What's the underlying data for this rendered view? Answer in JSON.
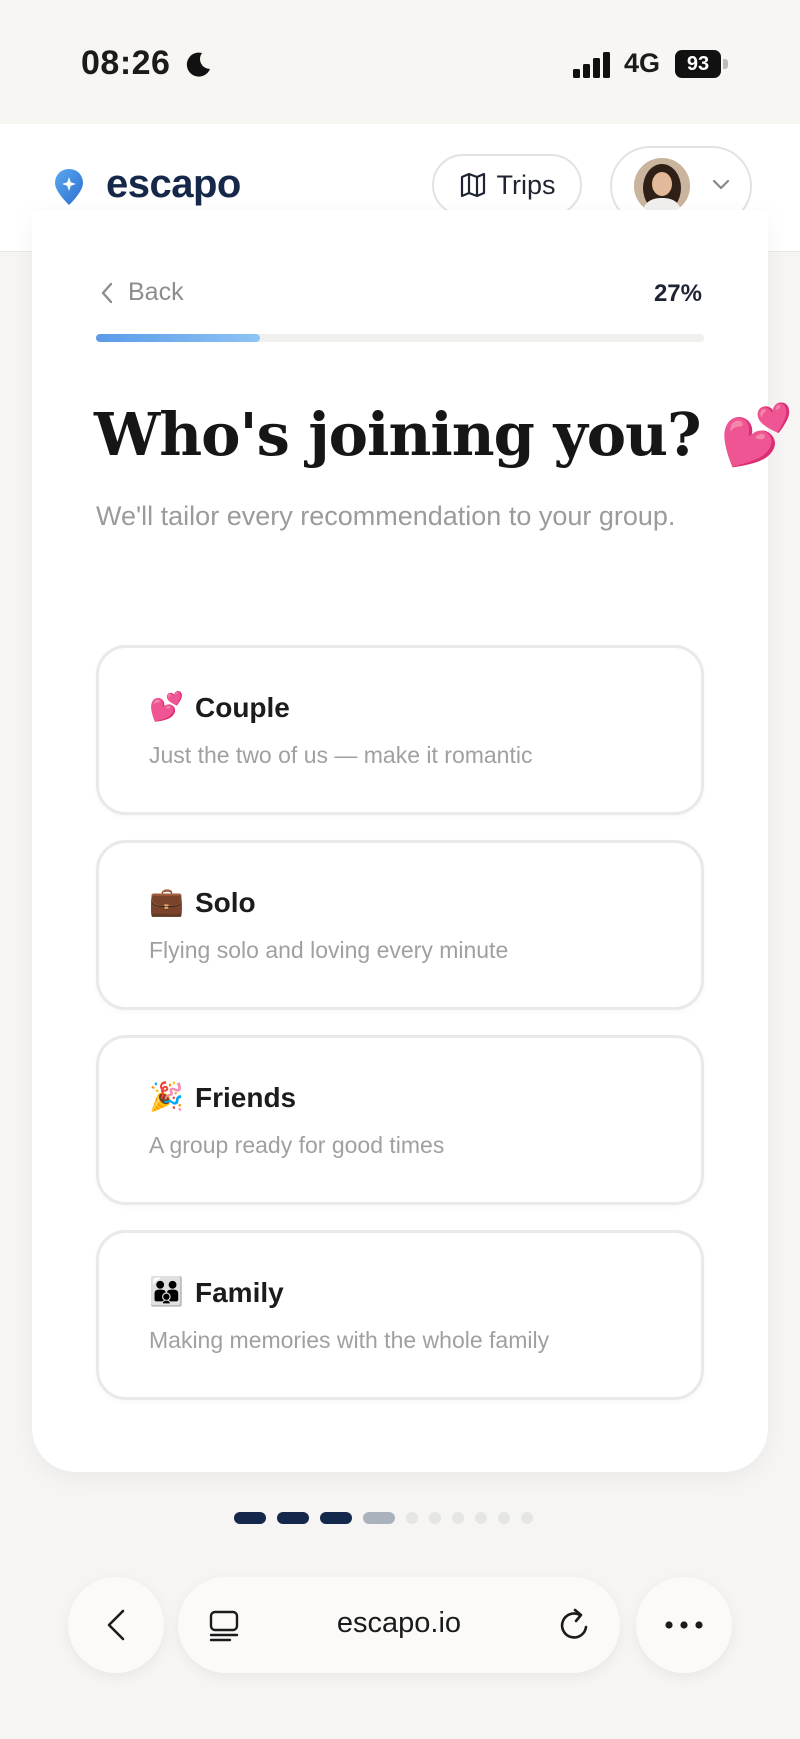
{
  "status_bar": {
    "time": "08:26",
    "network": "4G",
    "battery": "93"
  },
  "header": {
    "brand": "escapo",
    "trips_label": "Trips"
  },
  "progress": {
    "back_label": "Back",
    "percent_label": "27%",
    "value": 0.27
  },
  "question": {
    "title": "Who's joining you? 💕",
    "subtitle": "We'll tailor every recommendation to your group."
  },
  "options": [
    {
      "label": "Couple",
      "emoji": "💕",
      "icon": "two-hearts-icon",
      "description": "Just the two of us — make it romantic"
    },
    {
      "label": "Solo",
      "emoji": "💼",
      "icon": "suitcase-icon",
      "description": "Flying solo and loving every minute"
    },
    {
      "label": "Friends",
      "emoji": "🎉",
      "icon": "party-popper-icon",
      "description": "A group ready for good times"
    },
    {
      "label": "Family",
      "emoji": "👪",
      "icon": "family-icon",
      "description": "Making memories with the whole family"
    }
  ],
  "steps": {
    "completed": 3,
    "current": 4,
    "total": 10
  },
  "browser": {
    "url": "escapo.io"
  }
}
